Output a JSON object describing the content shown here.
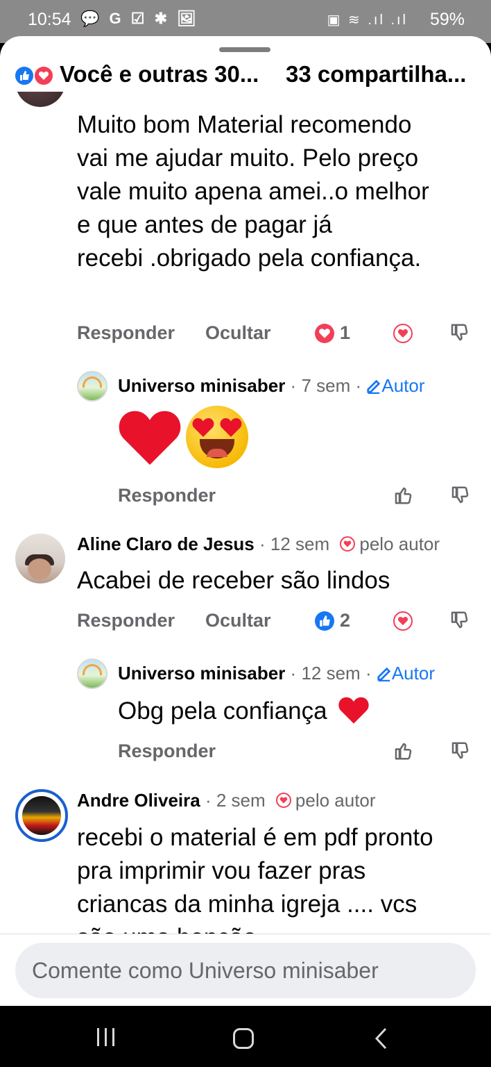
{
  "status_bar": {
    "time": "10:54",
    "left_icons": "💬 G ☑ ✱ 🖼",
    "right_icons": "▣ ≋ .ıl .ıl",
    "battery": "59%"
  },
  "header": {
    "reactions_text": "Você e outras 30...",
    "shares_text": "33 compartilha..."
  },
  "comments": [
    {
      "text_lines": [
        "Muito bom Material  recomendo",
        "vai me ajudar muito. Pelo preço",
        "vale muito apena amei..o melhor",
        "e que antes de pagar já",
        "recebi .obrigado  pela confiança."
      ],
      "reply_label": "Responder",
      "hide_label": "Ocultar",
      "reaction_count": "1"
    },
    {
      "author": "Aline Claro de Jesus",
      "time": "12 sem",
      "author_reaction": "pelo autor",
      "text": "Acabei de receber são lindos",
      "reply_label": "Responder",
      "hide_label": "Ocultar",
      "reaction_count": "2"
    },
    {
      "author": "Andre Oliveira",
      "time": "2 sem",
      "author_reaction": "pelo autor",
      "text_lines": [
        "recebi o material é em pdf pronto",
        "pra imprimir vou fazer pras",
        "criancas da minha igreja .... vcs",
        "são uma benção"
      ]
    }
  ],
  "replies": [
    {
      "author": "Universo minisaber",
      "time": "7 sem",
      "tag": "Autor",
      "reply_label": "Responder"
    },
    {
      "author": "Universo minisaber",
      "time": "12 sem",
      "tag": "Autor",
      "text": "Obg pela confiança",
      "reply_label": "Responder"
    }
  ],
  "composer": {
    "placeholder": "Comente como Universo minisaber"
  },
  "colors": {
    "like_blue": "#1877f2",
    "love_red": "#f33e58",
    "text": "#050505",
    "secondary": "#65676b"
  }
}
